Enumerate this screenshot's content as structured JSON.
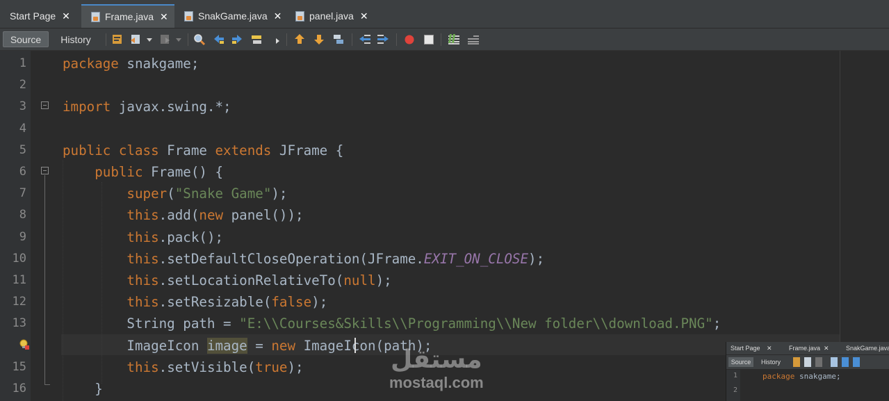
{
  "tabs": [
    {
      "label": "Start Page",
      "icon": "start-page-icon",
      "active": false
    },
    {
      "label": "Frame.java",
      "icon": "java-file-icon",
      "active": true
    },
    {
      "label": "SnakGame.java",
      "icon": "java-file-icon",
      "active": false
    },
    {
      "label": "panel.java",
      "icon": "java-file-icon",
      "active": false
    }
  ],
  "close_glyph": "✕",
  "toolbar": {
    "source_label": "Source",
    "history_label": "History",
    "icons": [
      "last-edit-icon",
      "back-icon",
      "forward-icon",
      "search-icon",
      "find-prev-icon",
      "find-next-icon",
      "toggle-highlight-icon",
      "toggle-bookmark-icon",
      "prev-bookmark-icon",
      "next-bookmark-icon",
      "shift-left-icon",
      "shift-right-icon",
      "record-macro-icon",
      "stop-macro-icon",
      "comment-icon",
      "uncomment-icon"
    ]
  },
  "editor": {
    "lines": [
      {
        "n": "1",
        "tokens": [
          [
            "kw",
            "package"
          ],
          [
            "plain",
            " snakgame;"
          ]
        ]
      },
      {
        "n": "2",
        "tokens": []
      },
      {
        "n": "3",
        "tokens": [
          [
            "kw",
            "import"
          ],
          [
            "plain",
            " javax.swing.*;"
          ]
        ]
      },
      {
        "n": "4",
        "tokens": []
      },
      {
        "n": "5",
        "tokens": [
          [
            "kw",
            "public class"
          ],
          [
            "plain",
            " Frame "
          ],
          [
            "kw",
            "extends"
          ],
          [
            "plain",
            " JFrame {"
          ]
        ]
      },
      {
        "n": "6",
        "tokens": [
          [
            "plain",
            "    "
          ],
          [
            "kw",
            "public"
          ],
          [
            "plain",
            " Frame() {"
          ]
        ]
      },
      {
        "n": "7",
        "tokens": [
          [
            "plain",
            "        "
          ],
          [
            "kw",
            "super"
          ],
          [
            "plain",
            "("
          ],
          [
            "str",
            "\"Snake Game\""
          ],
          [
            "plain",
            ");"
          ]
        ]
      },
      {
        "n": "8",
        "tokens": [
          [
            "plain",
            "        "
          ],
          [
            "kw",
            "this"
          ],
          [
            "plain",
            ".add("
          ],
          [
            "kw",
            "new"
          ],
          [
            "plain",
            " panel());"
          ]
        ]
      },
      {
        "n": "9",
        "tokens": [
          [
            "plain",
            "        "
          ],
          [
            "kw",
            "this"
          ],
          [
            "plain",
            ".pack();"
          ]
        ]
      },
      {
        "n": "10",
        "tokens": [
          [
            "plain",
            "        "
          ],
          [
            "kw",
            "this"
          ],
          [
            "plain",
            ".setDefaultCloseOperation(JFrame."
          ],
          [
            "itl",
            "EXIT_ON_CLOSE"
          ],
          [
            "plain",
            ");"
          ]
        ]
      },
      {
        "n": "11",
        "tokens": [
          [
            "plain",
            "        "
          ],
          [
            "kw",
            "this"
          ],
          [
            "plain",
            ".setLocationRelativeTo("
          ],
          [
            "kw",
            "null"
          ],
          [
            "plain",
            ");"
          ]
        ]
      },
      {
        "n": "12",
        "tokens": [
          [
            "plain",
            "        "
          ],
          [
            "kw",
            "this"
          ],
          [
            "plain",
            ".setResizable("
          ],
          [
            "kw",
            "false"
          ],
          [
            "plain",
            ");"
          ]
        ]
      },
      {
        "n": "13",
        "tokens": [
          [
            "plain",
            "        String path = "
          ],
          [
            "str",
            "\"E:\\\\Courses&Skills\\\\Programming\\\\New folder\\\\download.PNG\""
          ],
          [
            "plain",
            ";"
          ]
        ]
      },
      {
        "n": "",
        "tokens": [
          [
            "plain",
            "        ImageIcon "
          ],
          [
            "hl",
            "image"
          ],
          [
            "plain",
            " = "
          ],
          [
            "kw",
            "new"
          ],
          [
            "plain",
            " ImageIcon(path);"
          ]
        ]
      },
      {
        "n": "15",
        "tokens": [
          [
            "plain",
            "        "
          ],
          [
            "kw",
            "this"
          ],
          [
            "plain",
            ".setVisible("
          ],
          [
            "kw",
            "true"
          ],
          [
            "plain",
            ");"
          ]
        ]
      },
      {
        "n": "16",
        "tokens": [
          [
            "plain",
            "    }"
          ]
        ]
      }
    ]
  },
  "watermark": {
    "arabic": "مستقل",
    "latin": "mostaql.com"
  },
  "thumbnail": {
    "tabs": [
      "Start Page",
      "Frame.java",
      "SnakGame.java"
    ],
    "source_label": "Source",
    "history_label": "History",
    "line_numbers": [
      "1",
      "2"
    ],
    "code_kw": "package",
    "code_rest": " snakgame;"
  }
}
